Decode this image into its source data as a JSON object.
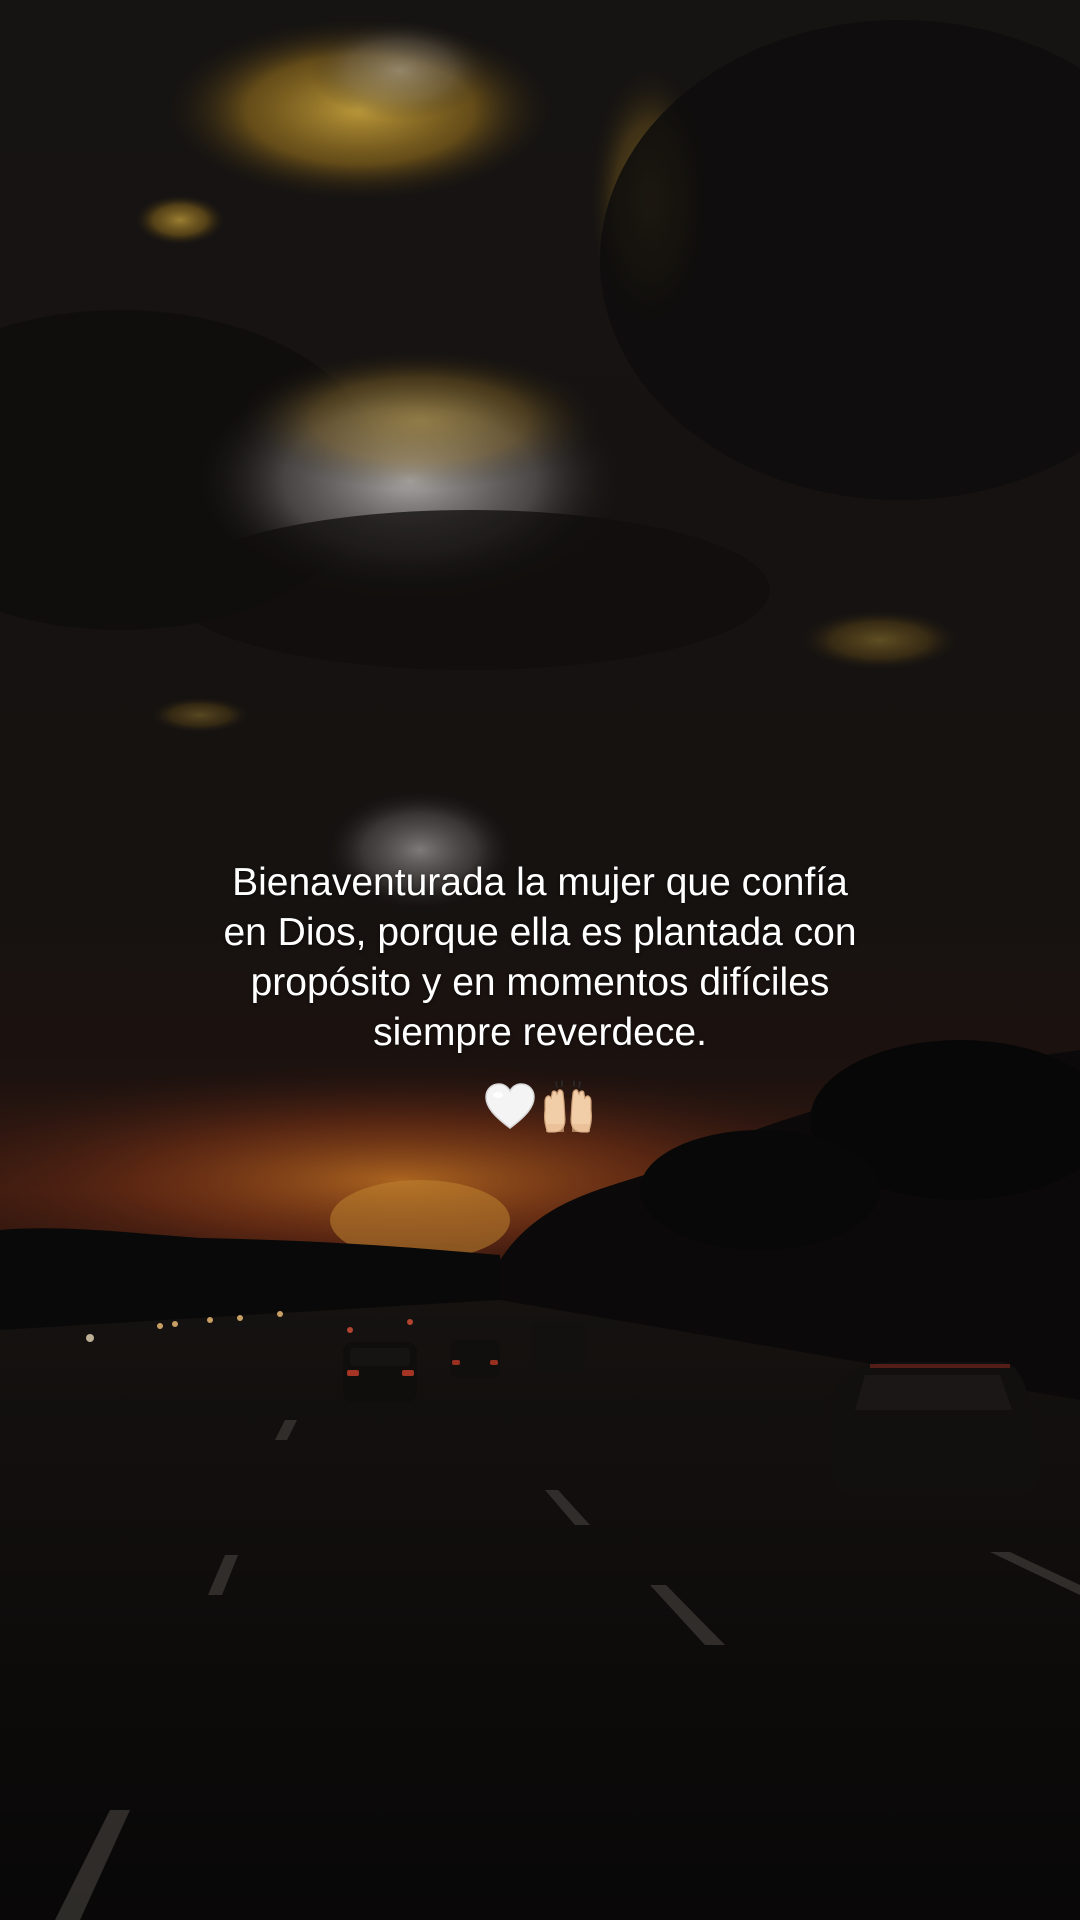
{
  "quote": {
    "lines": [
      "Bienaventurada la mujer que confía",
      "en Dios, porque ella es plantada con",
      "propósito y en momentos difíciles",
      "siempre reverdece."
    ]
  },
  "emojis": [
    "white-heart-icon",
    "raising-hands-icon"
  ],
  "colors": {
    "sky_dark": "#1b1716",
    "cloud_glow": "#e0a62a",
    "sunset": "#c8501e",
    "text": "#ffffff"
  }
}
